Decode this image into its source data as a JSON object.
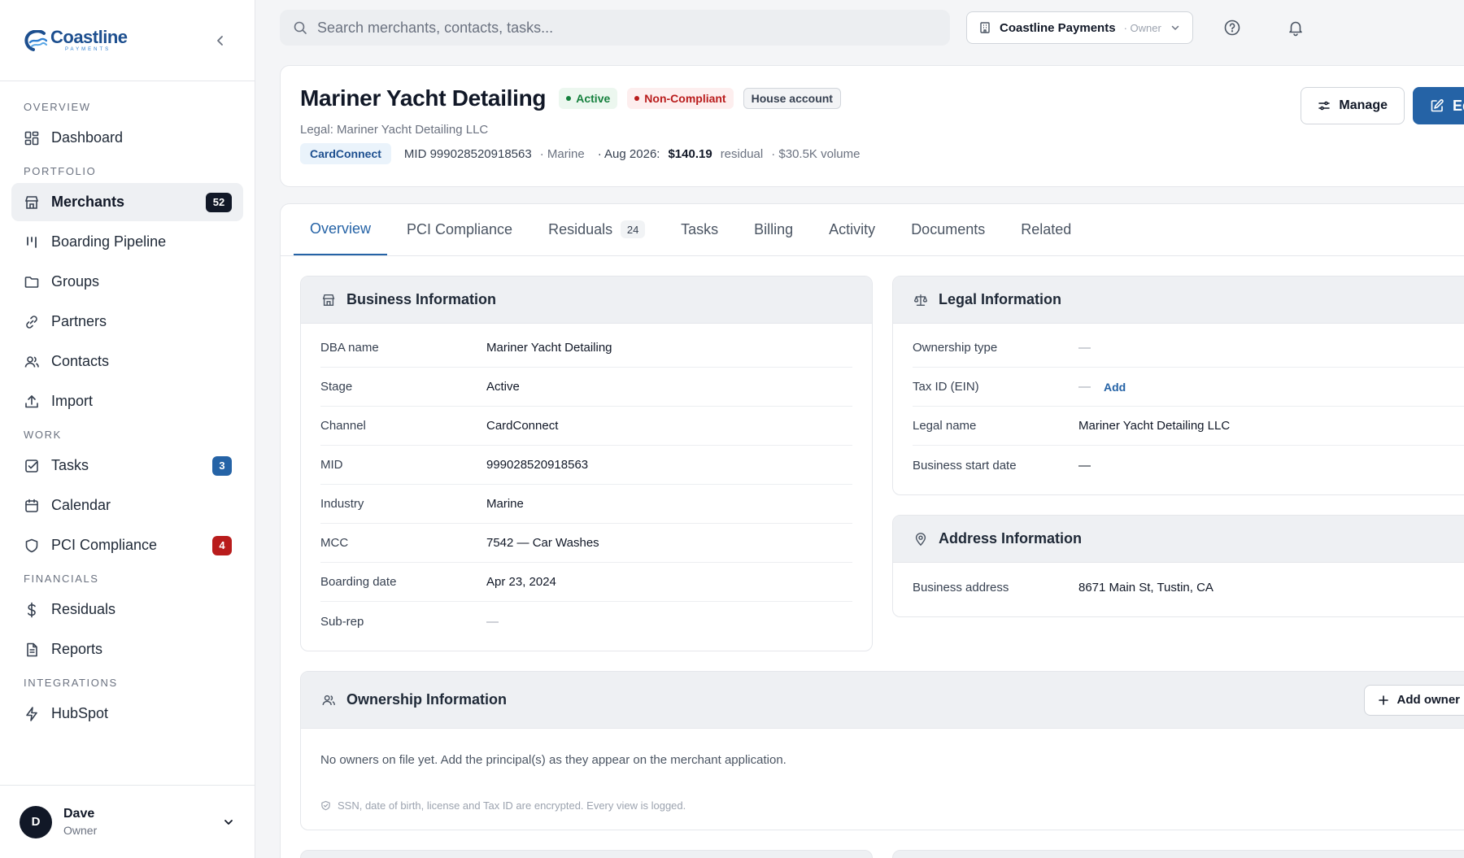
{
  "brand": {
    "name": "Coastline",
    "subtitle": "PAYMENTS",
    "colors": {
      "primary": "#2563a6",
      "dark": "#111827",
      "success": "#15803d",
      "danger": "#b91c1c"
    }
  },
  "sidebar": {
    "sections": [
      {
        "label": "OVERVIEW",
        "items": [
          {
            "label": "Dashboard",
            "icon": "dashboard-icon"
          }
        ]
      },
      {
        "label": "PORTFOLIO",
        "items": [
          {
            "label": "Merchants",
            "icon": "store-icon",
            "badge": "52",
            "active": true
          },
          {
            "label": "Boarding Pipeline",
            "icon": "pipeline-icon"
          },
          {
            "label": "Groups",
            "icon": "folder-icon"
          },
          {
            "label": "Partners",
            "icon": "link-icon"
          },
          {
            "label": "Contacts",
            "icon": "users-icon"
          },
          {
            "label": "Import",
            "icon": "upload-icon"
          }
        ]
      },
      {
        "label": "WORK",
        "items": [
          {
            "label": "Tasks",
            "icon": "checkbox-icon",
            "badge": "3"
          },
          {
            "label": "Calendar",
            "icon": "calendar-icon"
          },
          {
            "label": "PCI Compliance",
            "icon": "shield-icon",
            "badge": "4"
          }
        ]
      },
      {
        "label": "FINANCIALS",
        "items": [
          {
            "label": "Residuals",
            "icon": "dollar-icon"
          },
          {
            "label": "Reports",
            "icon": "document-icon"
          }
        ]
      },
      {
        "label": "INTEGRATIONS",
        "items": [
          {
            "label": "HubSpot",
            "icon": "bolt-icon"
          }
        ]
      }
    ],
    "user": {
      "initial": "D",
      "name": "Dave",
      "role": "Owner"
    }
  },
  "topbar": {
    "search_placeholder": "Search merchants, contacts, tasks...",
    "org_name": "Coastline Payments",
    "org_role": "· Owner"
  },
  "merchant": {
    "title": "Mariner Yacht Detailing",
    "status": "Active",
    "compliance": "Non-Compliant",
    "account_tag": "House account",
    "legal_line": "Legal: Mariner Yacht Detailing LLC",
    "channel_chip": "CardConnect",
    "mid_text": "MID 999028520918563",
    "industry_text": "· Marine",
    "period_label": "· Aug 2026:",
    "residual_amount": "$140.19",
    "residual_label": "residual",
    "volume_text": "· $30.5K volume",
    "actions": {
      "manage": "Manage",
      "edit": "Edit"
    }
  },
  "tabs": [
    {
      "label": "Overview",
      "active": true
    },
    {
      "label": "PCI Compliance"
    },
    {
      "label": "Residuals",
      "count": "24"
    },
    {
      "label": "Tasks"
    },
    {
      "label": "Billing"
    },
    {
      "label": "Activity"
    },
    {
      "label": "Documents"
    },
    {
      "label": "Related"
    }
  ],
  "business_info": {
    "title": "Business Information",
    "rows": [
      {
        "k": "DBA name",
        "v": "Mariner Yacht Detailing"
      },
      {
        "k": "Stage",
        "v": "Active"
      },
      {
        "k": "Channel",
        "v": "CardConnect"
      },
      {
        "k": "MID",
        "v": "999028520918563"
      },
      {
        "k": "Industry",
        "v": "Marine"
      },
      {
        "k": "MCC",
        "v": "7542 — Car Washes"
      },
      {
        "k": "Boarding date",
        "v": "Apr 23, 2024"
      },
      {
        "k": "Sub-rep",
        "v": "—"
      }
    ]
  },
  "legal_info": {
    "title": "Legal Information",
    "rows": [
      {
        "k": "Ownership type",
        "v": "—"
      },
      {
        "k": "Tax ID (EIN)",
        "v": "—",
        "action": "Add"
      },
      {
        "k": "Legal name",
        "v": "Mariner Yacht Detailing LLC"
      },
      {
        "k": "Business start date",
        "v": "—"
      }
    ]
  },
  "address_info": {
    "title": "Address Information",
    "rows": [
      {
        "k": "Business address",
        "v": "8671 Main St, Tustin, CA"
      }
    ]
  },
  "ownership_info": {
    "title": "Ownership Information",
    "add_label": "Add owner",
    "empty_text": "No owners on file yet. Add the principal(s) as they appear on the merchant application.",
    "security_note": "SSN, date of birth, license and Tax ID are encrypted. Every view is logged."
  }
}
